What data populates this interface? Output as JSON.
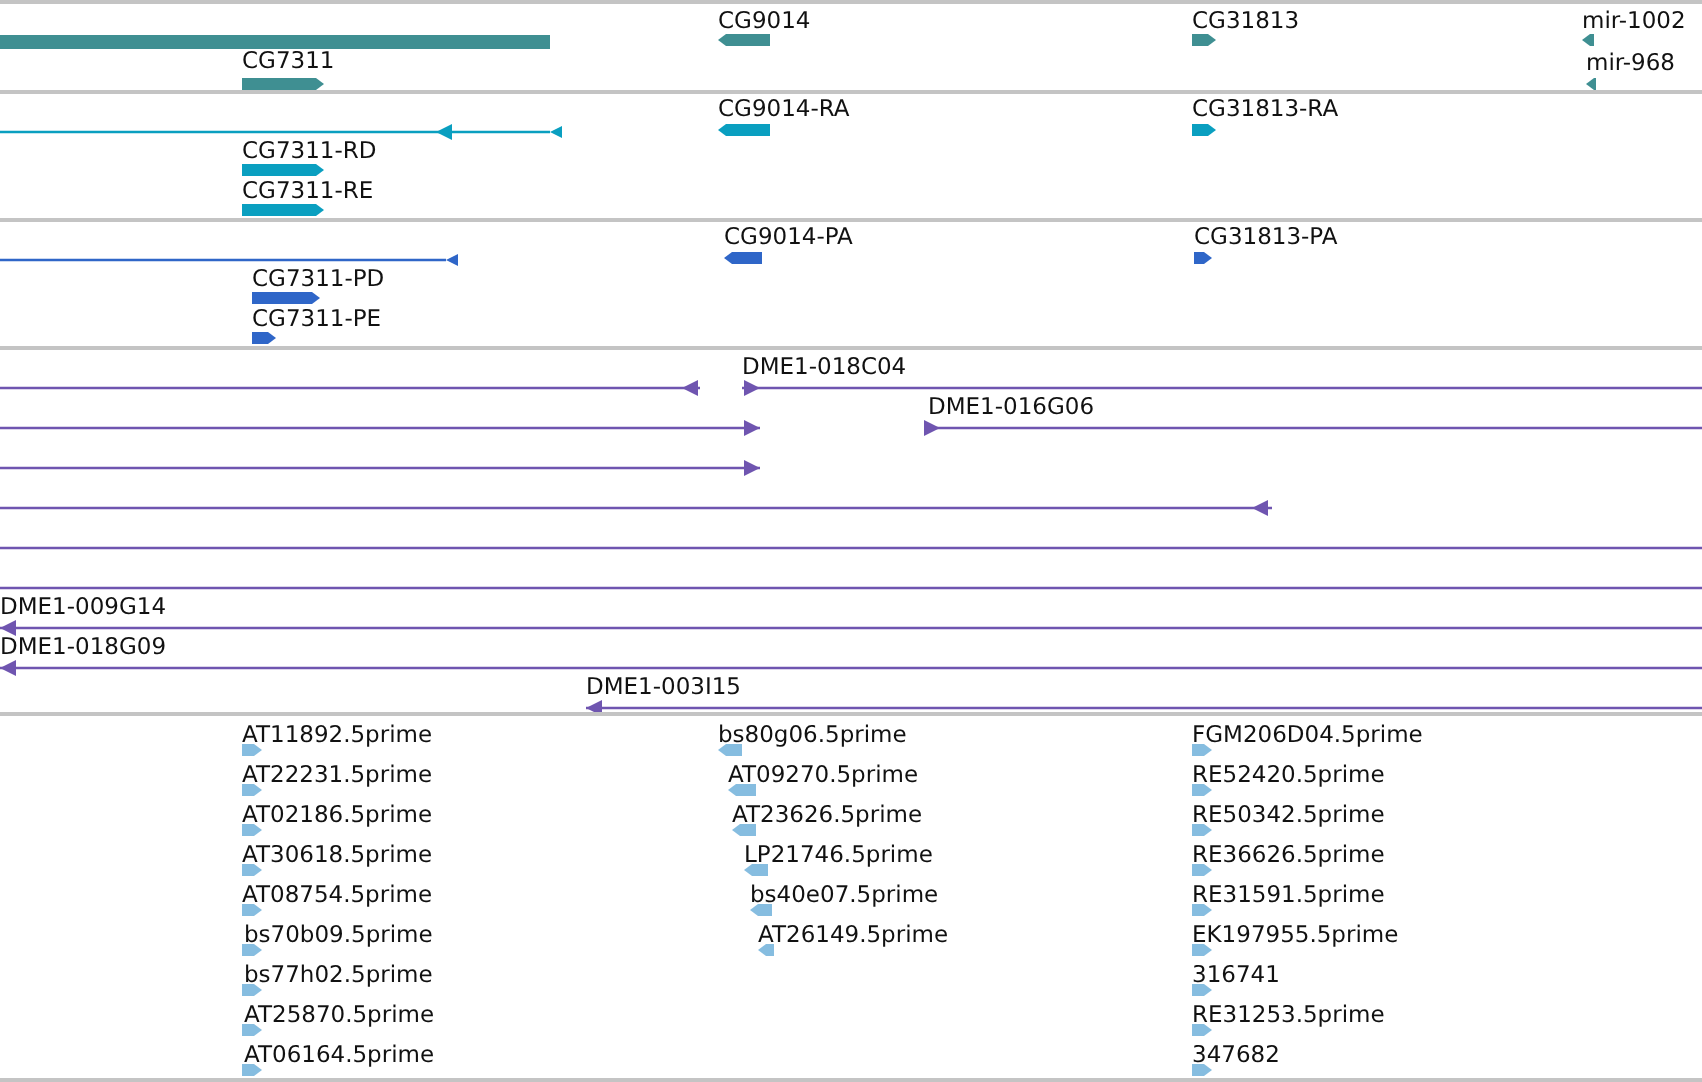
{
  "tracks": [
    {
      "color": "#3f8f92",
      "features": [
        {
          "kind": "bar"
        },
        {
          "kind": "block",
          "label": "CG7311",
          "reverse": false
        },
        {
          "kind": "block",
          "label": "CG9014",
          "reverse": true
        },
        {
          "kind": "block",
          "label": "CG31813",
          "reverse": false
        },
        {
          "kind": "block",
          "label": "mir-1002",
          "reverse": true
        },
        {
          "kind": "block",
          "label": "mir-968",
          "reverse": true
        }
      ]
    },
    {
      "color": "#0a9fc0",
      "features": [
        {
          "kind": "line",
          "reverse": true
        },
        {
          "kind": "block",
          "label": "CG9014-RA",
          "reverse": true
        },
        {
          "kind": "block",
          "label": "CG31813-RA",
          "reverse": false
        },
        {
          "kind": "block",
          "label": "CG7311-RD",
          "reverse": false
        },
        {
          "kind": "block",
          "label": "CG7311-RE",
          "reverse": false
        }
      ]
    },
    {
      "color": "#2f66c8",
      "features": [
        {
          "kind": "line",
          "reverse": true
        },
        {
          "kind": "block",
          "label": "CG9014-PA",
          "reverse": true
        },
        {
          "kind": "block",
          "label": "CG31813-PA",
          "reverse": false
        },
        {
          "kind": "block",
          "label": "CG7311-PD",
          "reverse": false
        },
        {
          "kind": "block",
          "label": "CG7311-PE",
          "reverse": false
        }
      ]
    },
    {
      "color": "#6f55b0",
      "features": [
        {
          "kind": "line",
          "reverse": true
        },
        {
          "kind": "line",
          "label": "DME1-018C04",
          "reverse": false
        },
        {
          "kind": "line",
          "reverse": false
        },
        {
          "kind": "line",
          "label": "DME1-016G06",
          "reverse": false
        },
        {
          "kind": "line",
          "reverse": false
        },
        {
          "kind": "line",
          "reverse": true
        },
        {
          "kind": "line"
        },
        {
          "kind": "line"
        },
        {
          "kind": "line",
          "label": "DME1-009G14",
          "reverse": true
        },
        {
          "kind": "line",
          "label": "DME1-018G09",
          "reverse": true
        },
        {
          "kind": "line",
          "label": "DME1-003I15",
          "reverse": true
        }
      ]
    },
    {
      "color": "#86bde0",
      "features": [
        {
          "kind": "block",
          "label": "AT11892.5prime",
          "reverse": false
        },
        {
          "kind": "block",
          "label": "bs80g06.5prime",
          "reverse": true
        },
        {
          "kind": "block",
          "label": "FGM206D04.5prime",
          "reverse": false
        },
        {
          "kind": "block",
          "label": "AT22231.5prime",
          "reverse": false
        },
        {
          "kind": "block",
          "label": "AT09270.5prime",
          "reverse": true
        },
        {
          "kind": "block",
          "label": "RE52420.5prime",
          "reverse": false
        },
        {
          "kind": "block",
          "label": "AT02186.5prime",
          "reverse": false
        },
        {
          "kind": "block",
          "label": "AT23626.5prime",
          "reverse": true
        },
        {
          "kind": "block",
          "label": "RE50342.5prime",
          "reverse": false
        },
        {
          "kind": "block",
          "label": "AT30618.5prime",
          "reverse": false
        },
        {
          "kind": "block",
          "label": "LP21746.5prime",
          "reverse": true
        },
        {
          "kind": "block",
          "label": "RE36626.5prime",
          "reverse": false
        },
        {
          "kind": "block",
          "label": "AT08754.5prime",
          "reverse": false
        },
        {
          "kind": "block",
          "label": "bs40e07.5prime",
          "reverse": true
        },
        {
          "kind": "block",
          "label": "RE31591.5prime",
          "reverse": false
        },
        {
          "kind": "block",
          "label": "bs70b09.5prime",
          "reverse": false
        },
        {
          "kind": "block",
          "label": "AT26149.5prime",
          "reverse": true
        },
        {
          "kind": "block",
          "label": "EK197955.5prime",
          "reverse": false
        },
        {
          "kind": "block",
          "label": "bs77h02.5prime",
          "reverse": false
        },
        {
          "kind": "block",
          "label": "316741",
          "reverse": false
        },
        {
          "kind": "block",
          "label": "AT25870.5prime",
          "reverse": false
        },
        {
          "kind": "block",
          "label": "RE31253.5prime",
          "reverse": false
        },
        {
          "kind": "block",
          "label": "AT06164.5prime",
          "reverse": false
        },
        {
          "kind": "block",
          "label": "347682",
          "reverse": false
        }
      ]
    }
  ]
}
